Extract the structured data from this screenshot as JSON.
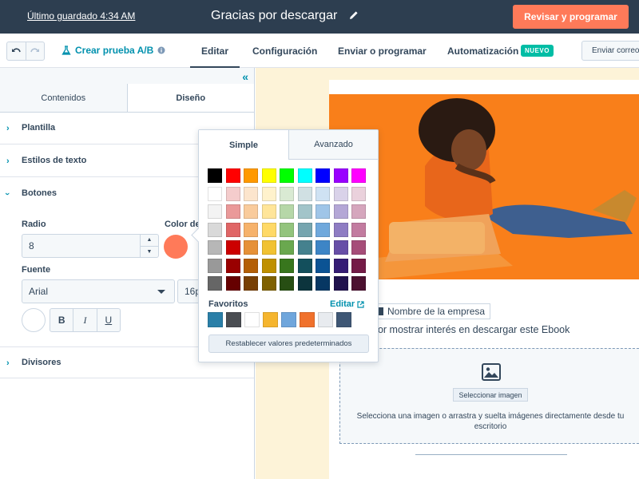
{
  "header": {
    "last_saved": "Último guardado 4:34 AM",
    "title": "Gracias por descargar",
    "review_button": "Revisar y programar"
  },
  "toolbar": {
    "ab_test": "Crear prueba A/B",
    "tabs": [
      {
        "label": "Editar",
        "active": true
      },
      {
        "label": "Configuración",
        "active": false
      },
      {
        "label": "Enviar o programar",
        "active": false
      },
      {
        "label": "Automatización",
        "active": false
      }
    ],
    "new_badge": "NUEVO",
    "send_mail": "Enviar correo"
  },
  "left_panel": {
    "tabs": [
      "Contenidos",
      "Diseño"
    ],
    "active_tab": "Diseño",
    "sections": {
      "template": "Plantilla",
      "text_styles": "Estilos de texto",
      "buttons": "Botones",
      "dividers": "Divisores"
    },
    "buttons_section": {
      "radius_label": "Radio",
      "radius_value": "8",
      "color_label": "Color de",
      "button_color": "#ff7a59",
      "font_label": "Fuente",
      "font_value": "Arial",
      "size_value": "16px",
      "format": {
        "bold": "B",
        "italic": "I",
        "underline": "U"
      }
    }
  },
  "color_picker": {
    "tabs": [
      "Simple",
      "Avanzado"
    ],
    "active_tab": "Simple",
    "swatches": [
      [
        "#000000",
        "#ff0000",
        "#ff9900",
        "#ffff00",
        "#00ff00",
        "#00ffff",
        "#0000ff",
        "#9900ff",
        "#ff00ff"
      ],
      [
        "#ffffff",
        "#f4cccc",
        "#fce5cd",
        "#fff2cc",
        "#d9ead3",
        "#d0e0e3",
        "#cfe2f3",
        "#d9d2e9",
        "#ead1dc"
      ],
      [
        "#f3f3f3",
        "#ea9999",
        "#f9cb9c",
        "#ffe599",
        "#b6d7a8",
        "#a2c4c9",
        "#9fc5e8",
        "#b4a7d6",
        "#d5a6bd"
      ],
      [
        "#d9d9d9",
        "#e06666",
        "#f6b26b",
        "#ffd966",
        "#93c47d",
        "#76a5af",
        "#6fa8dc",
        "#8e7cc3",
        "#c27ba0"
      ],
      [
        "#b7b7b7",
        "#cc0000",
        "#e69138",
        "#f1c232",
        "#6aa84f",
        "#45818e",
        "#3d85c6",
        "#674ea7",
        "#a64d79"
      ],
      [
        "#999999",
        "#990000",
        "#b45f06",
        "#bf9000",
        "#38761d",
        "#134f5c",
        "#0b5394",
        "#351c75",
        "#741b47"
      ],
      [
        "#666666",
        "#660000",
        "#783f04",
        "#7f6000",
        "#274e13",
        "#0c343d",
        "#073763",
        "#20124d",
        "#4c1130"
      ]
    ],
    "favorites_label": "Favoritos",
    "edit_label": "Editar",
    "favorites": [
      "#2a7fa8",
      "#4a4d52",
      "#ffffff",
      "#f5b52e",
      "#6fa6dc",
      "#f0712c",
      "#e8ebef",
      "#3f5775"
    ],
    "reset_label": "Restablecer valores predeterminados"
  },
  "preview": {
    "company_name": "Nombre de la empresa",
    "thanks_text": "por mostrar interés en descargar este Ebook",
    "select_image": "Seleccionar imagen",
    "drop_hint": "Selecciona una imagen o arrastra y suelta imágenes directamente desde tu escritorio"
  }
}
